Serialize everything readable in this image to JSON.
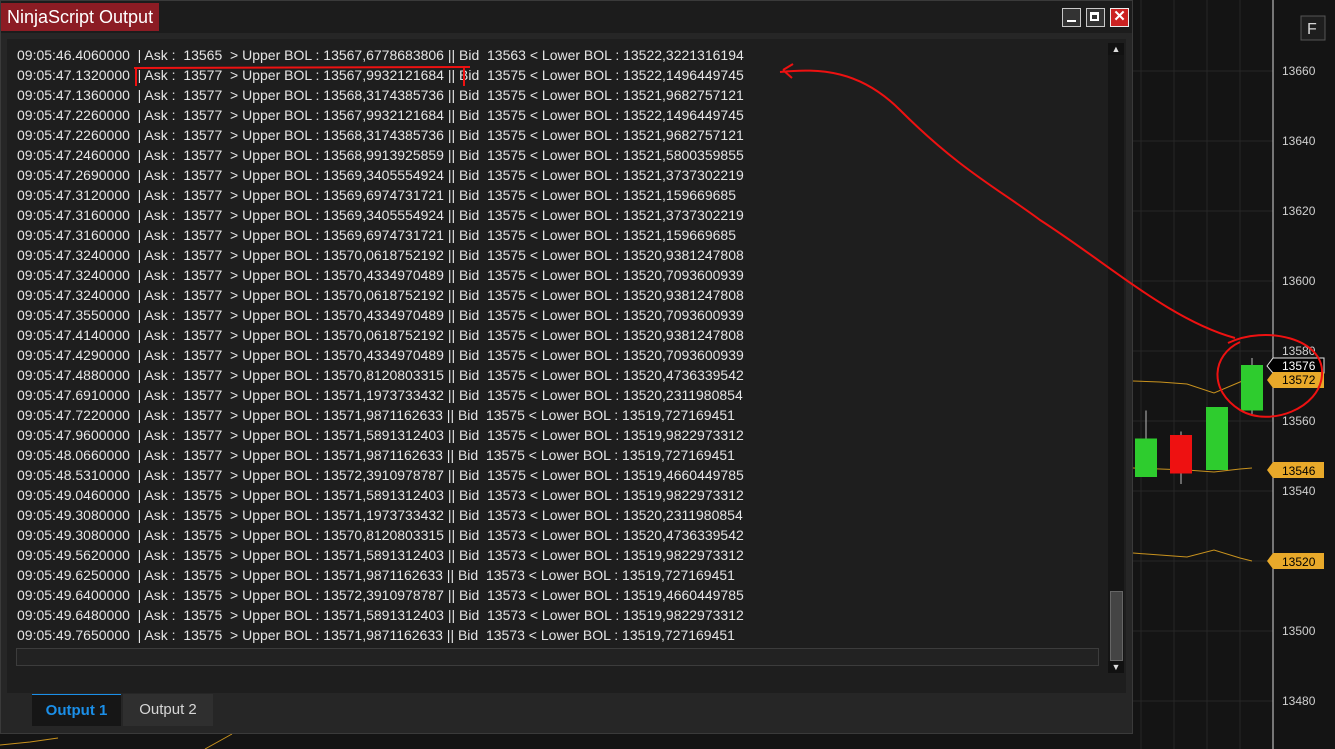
{
  "window": {
    "title": "NinjaScript Output",
    "close_glyph": "✕"
  },
  "tabs": [
    {
      "label": "Output 1",
      "active": true
    },
    {
      "label": "Output 2",
      "active": false
    }
  ],
  "scroll": {
    "up": "▲",
    "down": "▼"
  },
  "output_lines": [
    "09:05:46.4060000  | Ask :  13565  > Upper BOL : 13567,6778683806 || Bid  13563 < Lower BOL : 13522,3221316194",
    "09:05:47.1320000  | Ask :  13577  > Upper BOL : 13567,9932121684 || Bid  13575 < Lower BOL : 13522,1496449745",
    "09:05:47.1360000  | Ask :  13577  > Upper BOL : 13568,3174385736 || Bid  13575 < Lower BOL : 13521,9682757121",
    "09:05:47.2260000  | Ask :  13577  > Upper BOL : 13567,9932121684 || Bid  13575 < Lower BOL : 13522,1496449745",
    "09:05:47.2260000  | Ask :  13577  > Upper BOL : 13568,3174385736 || Bid  13575 < Lower BOL : 13521,9682757121",
    "09:05:47.2460000  | Ask :  13577  > Upper BOL : 13568,9913925859 || Bid  13575 < Lower BOL : 13521,5800359855",
    "09:05:47.2690000  | Ask :  13577  > Upper BOL : 13569,3405554924 || Bid  13575 < Lower BOL : 13521,3737302219",
    "09:05:47.3120000  | Ask :  13577  > Upper BOL : 13569,6974731721 || Bid  13575 < Lower BOL : 13521,159669685",
    "09:05:47.3160000  | Ask :  13577  > Upper BOL : 13569,3405554924 || Bid  13575 < Lower BOL : 13521,3737302219",
    "09:05:47.3160000  | Ask :  13577  > Upper BOL : 13569,6974731721 || Bid  13575 < Lower BOL : 13521,159669685",
    "09:05:47.3240000  | Ask :  13577  > Upper BOL : 13570,0618752192 || Bid  13575 < Lower BOL : 13520,9381247808",
    "09:05:47.3240000  | Ask :  13577  > Upper BOL : 13570,4334970489 || Bid  13575 < Lower BOL : 13520,7093600939",
    "09:05:47.3240000  | Ask :  13577  > Upper BOL : 13570,0618752192 || Bid  13575 < Lower BOL : 13520,9381247808",
    "09:05:47.3550000  | Ask :  13577  > Upper BOL : 13570,4334970489 || Bid  13575 < Lower BOL : 13520,7093600939",
    "09:05:47.4140000  | Ask :  13577  > Upper BOL : 13570,0618752192 || Bid  13575 < Lower BOL : 13520,9381247808",
    "09:05:47.4290000  | Ask :  13577  > Upper BOL : 13570,4334970489 || Bid  13575 < Lower BOL : 13520,7093600939",
    "09:05:47.4880000  | Ask :  13577  > Upper BOL : 13570,8120803315 || Bid  13575 < Lower BOL : 13520,4736339542",
    "09:05:47.6910000  | Ask :  13577  > Upper BOL : 13571,1973733432 || Bid  13575 < Lower BOL : 13520,2311980854",
    "09:05:47.7220000  | Ask :  13577  > Upper BOL : 13571,9871162633 || Bid  13575 < Lower BOL : 13519,727169451",
    "09:05:47.9600000  | Ask :  13577  > Upper BOL : 13571,5891312403 || Bid  13575 < Lower BOL : 13519,9822973312",
    "09:05:48.0660000  | Ask :  13577  > Upper BOL : 13571,9871162633 || Bid  13575 < Lower BOL : 13519,727169451",
    "09:05:48.5310000  | Ask :  13577  > Upper BOL : 13572,3910978787 || Bid  13575 < Lower BOL : 13519,4660449785",
    "09:05:49.0460000  | Ask :  13575  > Upper BOL : 13571,5891312403 || Bid  13573 < Lower BOL : 13519,9822973312",
    "09:05:49.3080000  | Ask :  13575  > Upper BOL : 13571,1973733432 || Bid  13573 < Lower BOL : 13520,2311980854",
    "09:05:49.3080000  | Ask :  13575  > Upper BOL : 13570,8120803315 || Bid  13573 < Lower BOL : 13520,4736339542",
    "09:05:49.5620000  | Ask :  13575  > Upper BOL : 13571,5891312403 || Bid  13573 < Lower BOL : 13519,9822973312",
    "09:05:49.6250000  | Ask :  13575  > Upper BOL : 13571,9871162633 || Bid  13573 < Lower BOL : 13519,727169451",
    "09:05:49.6400000  | Ask :  13575  > Upper BOL : 13572,3910978787 || Bid  13573 < Lower BOL : 13519,4660449785",
    "09:05:49.6480000  | Ask :  13575  > Upper BOL : 13571,5891312403 || Bid  13573 < Lower BOL : 13519,9822973312",
    "09:05:49.7650000  | Ask :  13575  > Upper BOL : 13571,9871162633 || Bid  13573 < Lower BOL : 13519,727169451"
  ],
  "chart": {
    "corner_button": "F",
    "price_labels": [
      "13660",
      "13640",
      "13620",
      "13600",
      "13580",
      "13560",
      "13540",
      "13500",
      "13480"
    ],
    "markers": [
      {
        "value": "13576",
        "kind": "last-price",
        "color": "#000000"
      },
      {
        "value": "13572",
        "kind": "upper-band",
        "color": "#e8a92a"
      },
      {
        "value": "13546",
        "kind": "middle-band",
        "color": "#e8a92a"
      },
      {
        "value": "13520",
        "kind": "lower-band",
        "color": "#e8a92a"
      }
    ],
    "candles": [
      {
        "open": 13544,
        "close": 13555,
        "high": 13563,
        "low": 13544,
        "color": "#2ecc2e"
      },
      {
        "open": 13556,
        "close": 13545,
        "high": 13557,
        "low": 13542,
        "color": "#ee1111"
      },
      {
        "open": 13546,
        "close": 13564,
        "high": 13564,
        "low": 13546,
        "color": "#2ecc2e"
      },
      {
        "open": 13563,
        "close": 13576,
        "high": 13578,
        "low": 13562,
        "color": "#2ecc2e"
      }
    ],
    "annotation_color": "#ee1111"
  }
}
